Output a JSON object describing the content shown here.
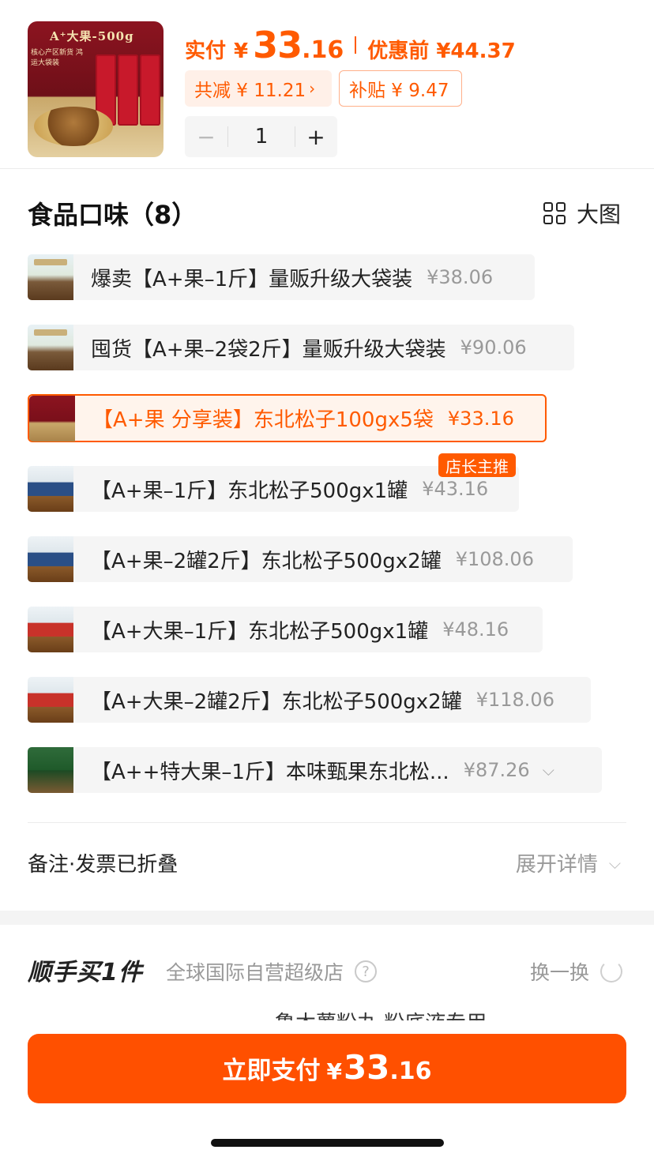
{
  "header": {
    "thumb_badge": "A⁺大果-500g",
    "thumb_tagline": "核心产区新货 鸿运大袋装",
    "paid_label": "实付",
    "currency": "¥",
    "paid_int": "33",
    "paid_dec": ".16",
    "before_label": "优惠前 ¥44.37",
    "reduce_chip": "共减 ¥ 11.21",
    "reduce_arrow": "›",
    "subsidy_chip": "补贴 ¥ 9.47",
    "quantity": "1",
    "minus": "−",
    "plus": "+"
  },
  "flavors": {
    "title": "食品口味（8）",
    "bigview_label": "大图",
    "recommend_tag": "店长主推",
    "items": [
      {
        "name": "爆卖【A+果–1斤】量贩升级大袋装",
        "price": "¥38.06"
      },
      {
        "name": "囤货【A+果–2袋2斤】量贩升级大袋装",
        "price": "¥90.06"
      },
      {
        "name": "【A+果 分享装】东北松子100gx5袋",
        "price": "¥33.16"
      },
      {
        "name": "【A+果–1斤】东北松子500gx1罐",
        "price": "¥43.16"
      },
      {
        "name": "【A+果–2罐2斤】东北松子500gx2罐",
        "price": "¥108.06"
      },
      {
        "name": "【A+大果–1斤】东北松子500gx1罐",
        "price": "¥48.16"
      },
      {
        "name": "【A+大果–2罐2斤】东北松子500gx2罐",
        "price": "¥118.06"
      },
      {
        "name": "【A++特大果–1斤】本味甄果东北松...",
        "price": "¥87.26"
      }
    ],
    "selected_index": 2
  },
  "remarks": {
    "label": "备注·发票已折叠",
    "expand_label": "展开详情"
  },
  "addon": {
    "title": "顺手买1件",
    "store": "全球国际自营超级店",
    "swap_label": "换一换",
    "peek_text": "魯木薯粉丸 粉底液专用"
  },
  "pay": {
    "label": "立即支付",
    "currency": "¥",
    "int": "33",
    "dec": ".16"
  },
  "colors": {
    "accent": "#ff5000",
    "selected_bg": "#fff4ec",
    "option_bg": "#f5f5f5",
    "muted_text": "#999999"
  }
}
